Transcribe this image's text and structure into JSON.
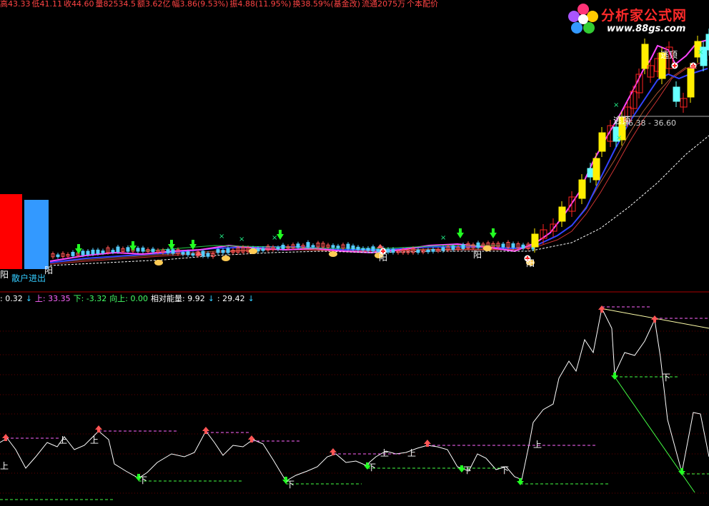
{
  "header": {
    "items": [
      {
        "text": "高43.33",
        "color": "#ff4444"
      },
      {
        "text": "低41.11",
        "color": "#ff4444"
      },
      {
        "text": "收44.60",
        "color": "#ff4444"
      },
      {
        "text": "量82534.5",
        "color": "#ff4444"
      },
      {
        "text": "额3.62亿",
        "color": "#ff4444"
      },
      {
        "text": "幅3.86(9.53%)",
        "color": "#ff4444"
      },
      {
        "text": "振4.88(11.95%)",
        "color": "#ff4444"
      },
      {
        "text": "换38.59%(基金改)",
        "color": "#ff4444"
      },
      {
        "text": "流通2075万",
        "color": "#ff4444"
      },
      {
        "text": "个本配价",
        "color": "#ff4444"
      }
    ]
  },
  "logo": {
    "name": "分析家公式网",
    "url": "www.88gs.com",
    "icon": "flower-icon"
  },
  "main_chart": {
    "labels": {
      "escape_top": "逃顶",
      "price_range": "36.38 - 36.60",
      "yang": "阳",
      "retail": "散户进出"
    },
    "colors": {
      "up": "#ffee00",
      "down": "#ff2222",
      "ma_fast": "#ff44ff",
      "ma_mid": "#3344ff",
      "ma_slow": "#cc3333",
      "white_dash": "#ffffff",
      "bar_red": "#ff0000",
      "bar_blue": "#3399ff"
    }
  },
  "sub_chart": {
    "readouts": [
      {
        "text": ": 0.32",
        "color": "#ffffff"
      },
      {
        "text": "↓",
        "color": "#33ccff"
      },
      {
        "text": "上: 33.35",
        "color": "#ff66ff"
      },
      {
        "text": "下: -3.32",
        "color": "#44ff66"
      },
      {
        "text": "向上: 0.00",
        "color": "#44ff66"
      },
      {
        "text": "相对能量: 9.92",
        "color": "#ffffff"
      },
      {
        "text": "↓",
        "color": "#33ccff"
      },
      {
        "text": ": 29.42",
        "color": "#ffffff"
      },
      {
        "text": "↓",
        "color": "#33ccff"
      }
    ],
    "markers": {
      "up": "上",
      "down": "下"
    }
  }
}
